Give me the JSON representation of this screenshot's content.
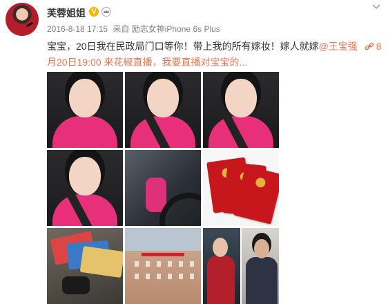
{
  "post": {
    "author_name": "芙蓉姐姐",
    "verified_badge_icon": "gold-v-verified-icon",
    "member_icon": "crown-member-icon",
    "menu_icon": "chevron-down-icon",
    "timestamp": "2016-8-18 17:15",
    "source": "来自 励志女神iPhone 6s Plus",
    "text_part1": "宝宝，20日我在民政局门口等你！带上我的所有嫁妆！嫁人就嫁",
    "mention": "@王宝强",
    "link_icon": "link-icon",
    "link_text": "8月20日19:00 来花椒直播，我要直播对宝宝的...",
    "colors": {
      "link": "#eb7350",
      "text": "#333333",
      "meta": "#808080"
    },
    "images": [
      {
        "kind": "selfie-pink"
      },
      {
        "kind": "selfie-pink"
      },
      {
        "kind": "selfie-pink"
      },
      {
        "kind": "selfie-pink"
      },
      {
        "kind": "driving-selfie"
      },
      {
        "kind": "marriage-certificates"
      },
      {
        "kind": "wallet-cards-car-key"
      },
      {
        "kind": "civil-affairs-building"
      },
      {
        "kind": "couple-portraits"
      }
    ]
  }
}
